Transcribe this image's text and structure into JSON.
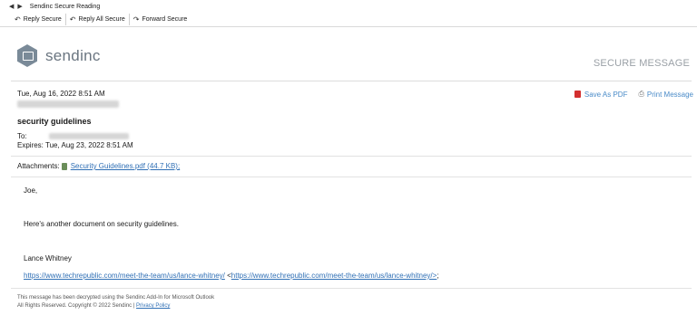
{
  "window": {
    "title": "Sendinc Secure Reading"
  },
  "toolbar": {
    "reply": "Reply Secure",
    "reply_all": "Reply All Secure",
    "forward": "Forward Secure"
  },
  "brand": {
    "name": "sendinc",
    "tagline": "SECURE MESSAGE",
    "color": "#7a8a98"
  },
  "message": {
    "date": "Tue, Aug 16, 2022 8:51 AM",
    "subject": "security guidelines",
    "to_label": "To:",
    "expires_label": "Expires:",
    "expires_value": "Tue, Aug 23, 2022 8:51 AM",
    "actions": {
      "save_pdf": "Save As PDF",
      "print": "Print Message"
    },
    "attachments_label": "Attachments:",
    "attachment_name": "Security Guidelines.pdf (44.7 KB);",
    "body": {
      "greeting": "Joe,",
      "line1": "Here's another document on security guidelines.",
      "signature": "Lance Whitney",
      "link": "https://www.techrepublic.com/meet-the-team/us/lance-whitney/",
      "link_open": " <",
      "link_repeat": "https://www.techrepublic.com/meet-the-team/us/lance-whitney/>",
      "link_close": ";"
    }
  },
  "footer": {
    "line1": "This message has been decrypted using the Sendinc Add-In for Microsoft Outlook",
    "line2": "All Rights Reserved. Copyright © 2022 Sendinc | ",
    "privacy": "Privacy Policy"
  },
  "colors": {
    "link": "#2f6fb5",
    "pdf": "#d32f2f",
    "action": "#4a8bc8"
  }
}
